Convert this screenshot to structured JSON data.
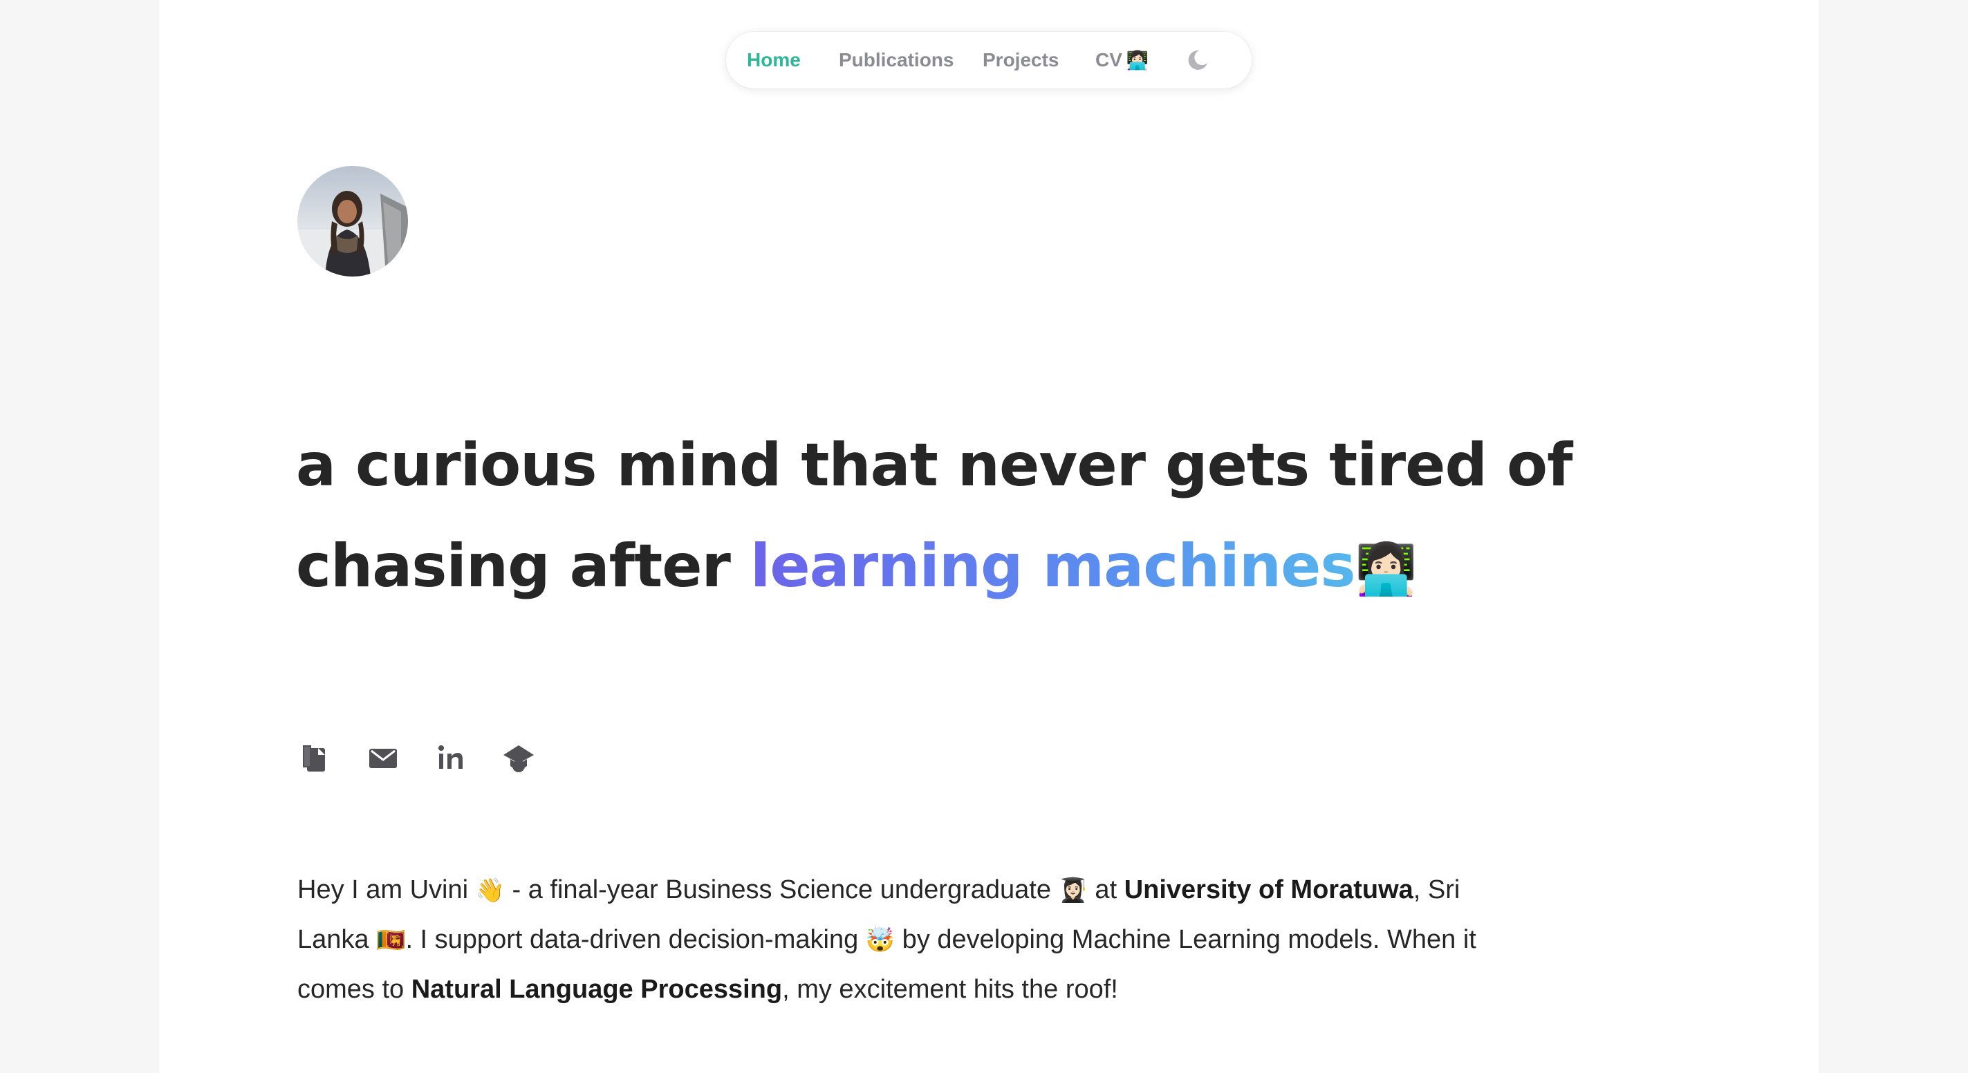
{
  "nav": {
    "items": [
      {
        "label": "Home"
      },
      {
        "label": "Publications"
      },
      {
        "label": "Projects"
      },
      {
        "label": "CV",
        "emoji": "👩🏻‍💻"
      }
    ],
    "active_color": "#2fb59a",
    "theme_toggle_icon": "moon-icon"
  },
  "profile": {
    "avatar_icon": "profile-photo"
  },
  "headline": {
    "line1": "a curious mind that never gets tired of",
    "line2_prefix": "chasing after ",
    "highlight": "learning machines",
    "emoji": "👩🏻‍💻"
  },
  "social": {
    "icons": [
      "google-scholar-paper-icon",
      "email-icon",
      "linkedin-icon",
      "graduation-cap-icon"
    ]
  },
  "bio": {
    "part1": "Hey I am Uvini ",
    "wave_emoji": "👋",
    "part2": " - a final-year Business Science undergraduate ",
    "student_emoji": "👩🏻‍🎓",
    "part3": " at ",
    "university": "University of Moratuwa",
    "part4": ", Sri Lanka ",
    "flag_emoji": "🇱🇰",
    "part5": ". I support data-driven decision-making ",
    "mindblown_emoji": "🤯",
    "part6": " by developing Machine Learning models. When it comes to ",
    "nlp": "Natural Language Processing",
    "part7": ", my excitement hits the roof!"
  },
  "colors": {
    "gradient_start": "#6b63ea",
    "gradient_end": "#56b6ec",
    "text": "#262626",
    "nav_text": "#8b8b93"
  }
}
